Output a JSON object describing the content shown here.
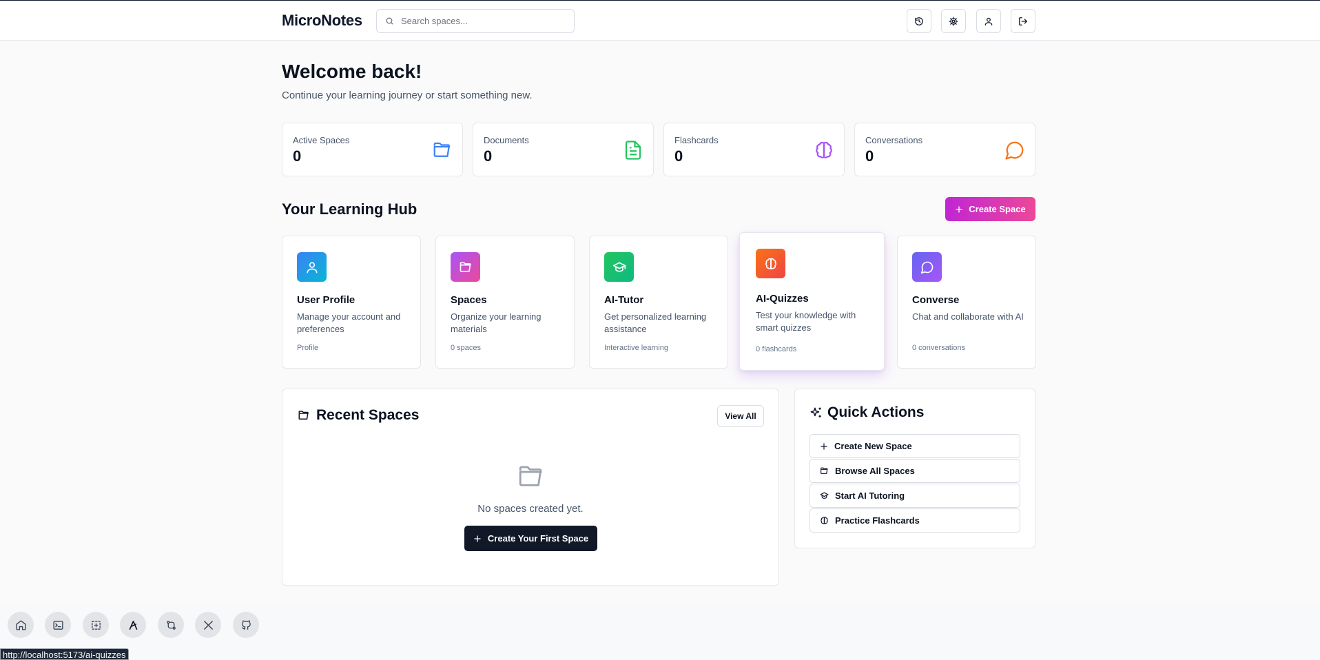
{
  "app": {
    "title": "MicroNotes"
  },
  "search": {
    "placeholder": "Search spaces..."
  },
  "header": {
    "icons": [
      "history-icon",
      "settings-icon",
      "user-icon",
      "logout-icon"
    ]
  },
  "welcome": {
    "title": "Welcome back!",
    "subtitle": "Continue your learning journey or start something new."
  },
  "stats": [
    {
      "label": "Active Spaces",
      "value": "0",
      "icon": "folder-open-icon",
      "color": "#3b82f6"
    },
    {
      "label": "Documents",
      "value": "0",
      "icon": "document-icon",
      "color": "#22c55e"
    },
    {
      "label": "Flashcards",
      "value": "0",
      "icon": "brain-icon",
      "color": "#a855f7"
    },
    {
      "label": "Conversations",
      "value": "0",
      "icon": "chat-icon",
      "color": "#f97316"
    }
  ],
  "hub": {
    "title": "Your Learning Hub",
    "create_label": "Create Space",
    "cards": [
      {
        "title": "User Profile",
        "desc": "Manage your account and preferences",
        "meta": "Profile",
        "icon": "user-icon",
        "colors": [
          "#3b82f6",
          "#06b6d4"
        ]
      },
      {
        "title": "Spaces",
        "desc": "Organize your learning materials",
        "meta": "0 spaces",
        "icon": "folder-open-icon",
        "colors": [
          "#a855f7",
          "#ec4899"
        ]
      },
      {
        "title": "AI-Tutor",
        "desc": "Get personalized learning assistance",
        "meta": "Interactive learning",
        "icon": "graduation-cap-icon",
        "colors": [
          "#22c55e",
          "#10b981"
        ]
      },
      {
        "title": "AI-Quizzes",
        "desc": "Test your knowledge with smart quizzes",
        "meta": "0 flashcards",
        "icon": "brain-icon",
        "colors": [
          "#f97316",
          "#ef4444"
        ]
      },
      {
        "title": "Converse",
        "desc": "Chat and collaborate with AI",
        "meta": "0 conversations",
        "icon": "chat-icon",
        "colors": [
          "#6366f1",
          "#a855f7"
        ]
      }
    ]
  },
  "recent": {
    "title": "Recent Spaces",
    "view_all": "View All",
    "empty_text": "No spaces created yet.",
    "first_space_label": "Create Your First Space"
  },
  "quick_actions": {
    "title": "Quick Actions",
    "items": [
      {
        "label": "Create New Space",
        "icon": "plus-icon"
      },
      {
        "label": "Browse All Spaces",
        "icon": "folder-open-icon"
      },
      {
        "label": "Start AI Tutoring",
        "icon": "graduation-cap-icon"
      },
      {
        "label": "Practice Flashcards",
        "icon": "brain-icon"
      }
    ]
  },
  "dock": {
    "icons": [
      "home-icon",
      "terminal-icon",
      "screenshot-icon",
      "app-logo-icon",
      "sync-icon",
      "x-logo-icon",
      "github-icon"
    ]
  },
  "status_bar": {
    "url": "http://localhost:5173/ai-quizzes"
  },
  "colors": {
    "brand_gradient_start": "#c026d3",
    "brand_gradient_end": "#ec4899",
    "dark_button": "#111827"
  }
}
